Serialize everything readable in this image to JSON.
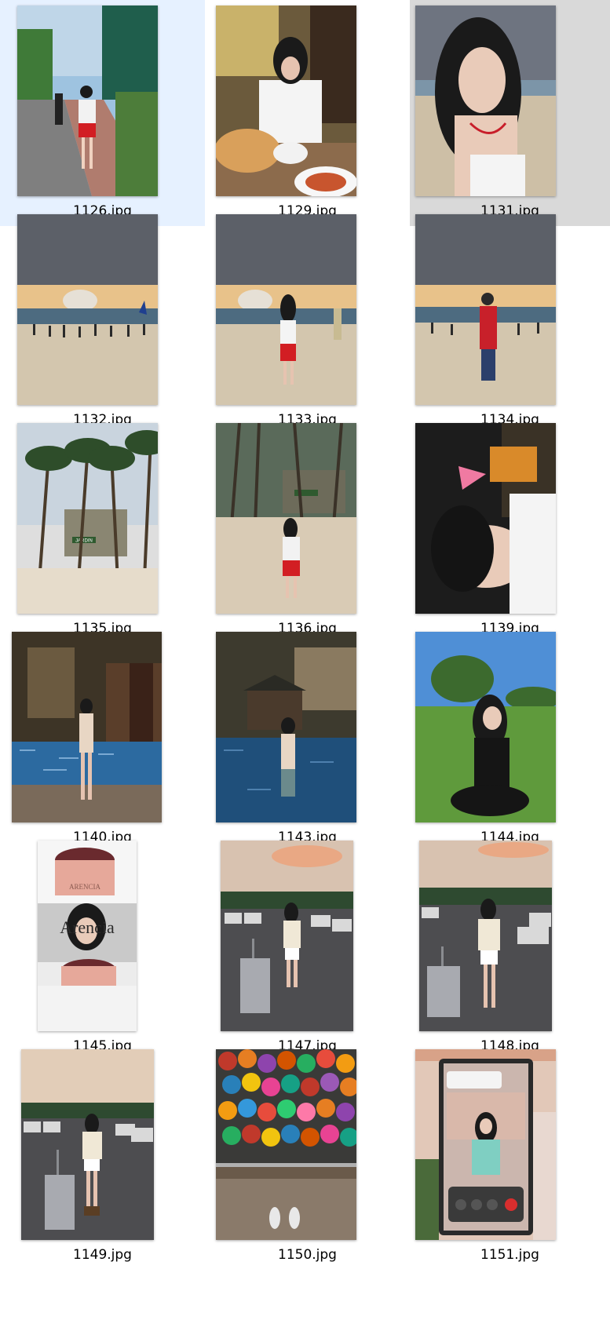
{
  "files": [
    {
      "name": "1126.jpg",
      "state": "selected"
    },
    {
      "name": "1129.jpg",
      "state": "normal"
    },
    {
      "name": "1131.jpg",
      "state": "hovered"
    },
    {
      "name": "1132.jpg",
      "state": "normal"
    },
    {
      "name": "1133.jpg",
      "state": "normal"
    },
    {
      "name": "1134.jpg",
      "state": "normal"
    },
    {
      "name": "1135.jpg",
      "state": "normal"
    },
    {
      "name": "1136.jpg",
      "state": "normal"
    },
    {
      "name": "1139.jpg",
      "state": "normal"
    },
    {
      "name": "1140.jpg",
      "state": "normal"
    },
    {
      "name": "1143.jpg",
      "state": "normal"
    },
    {
      "name": "1144.jpg",
      "state": "normal"
    },
    {
      "name": "1145.jpg",
      "state": "normal"
    },
    {
      "name": "1147.jpg",
      "state": "normal"
    },
    {
      "name": "1148.jpg",
      "state": "normal"
    },
    {
      "name": "1149.jpg",
      "state": "normal"
    },
    {
      "name": "1150.jpg",
      "state": "normal"
    },
    {
      "name": "1151.jpg",
      "state": "normal"
    }
  ],
  "colors": {
    "selected_background": "#e6f1ff",
    "hover_background": "#d9d9d9",
    "label_text": "#000000"
  },
  "photo_text": {
    "jardin_sign": "JARDIN",
    "arencia_overlay": "Arencia",
    "arencia_jar": "ARENCIA"
  }
}
